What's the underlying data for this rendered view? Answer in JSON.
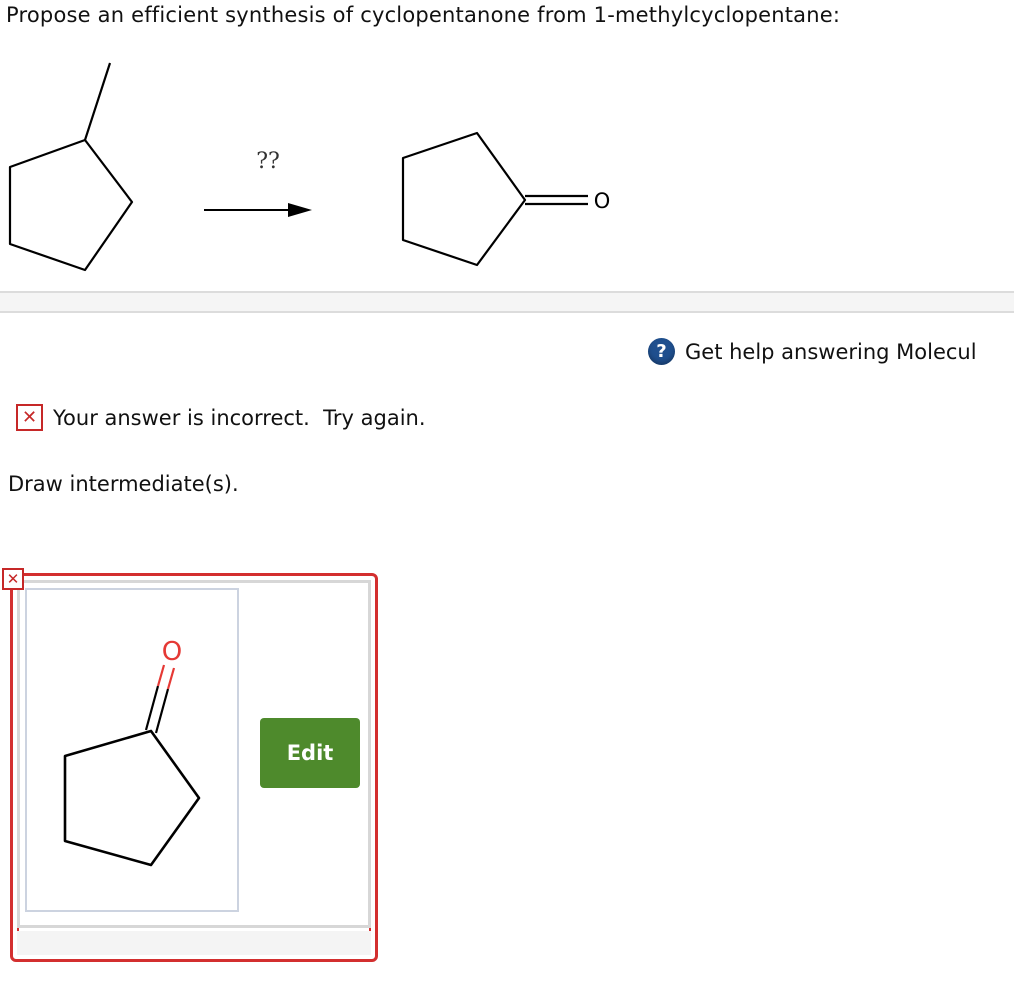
{
  "question": {
    "text": "Propose an efficient synthesis of cyclopentanone from 1-methylcyclopentane:"
  },
  "scheme": {
    "arrow_label": "??",
    "product_oxygen": "O"
  },
  "help": {
    "text": "Get help answering Molecul",
    "icon": "question-circle-icon"
  },
  "feedback": {
    "text": "Your answer is incorrect.  Try again.",
    "icon": "x-icon",
    "color": "#c62828"
  },
  "prompt": {
    "text": "Draw intermediate(s)."
  },
  "answer": {
    "oxygen_label": "O",
    "edit_label": "Edit",
    "status_icon": "x-icon"
  }
}
